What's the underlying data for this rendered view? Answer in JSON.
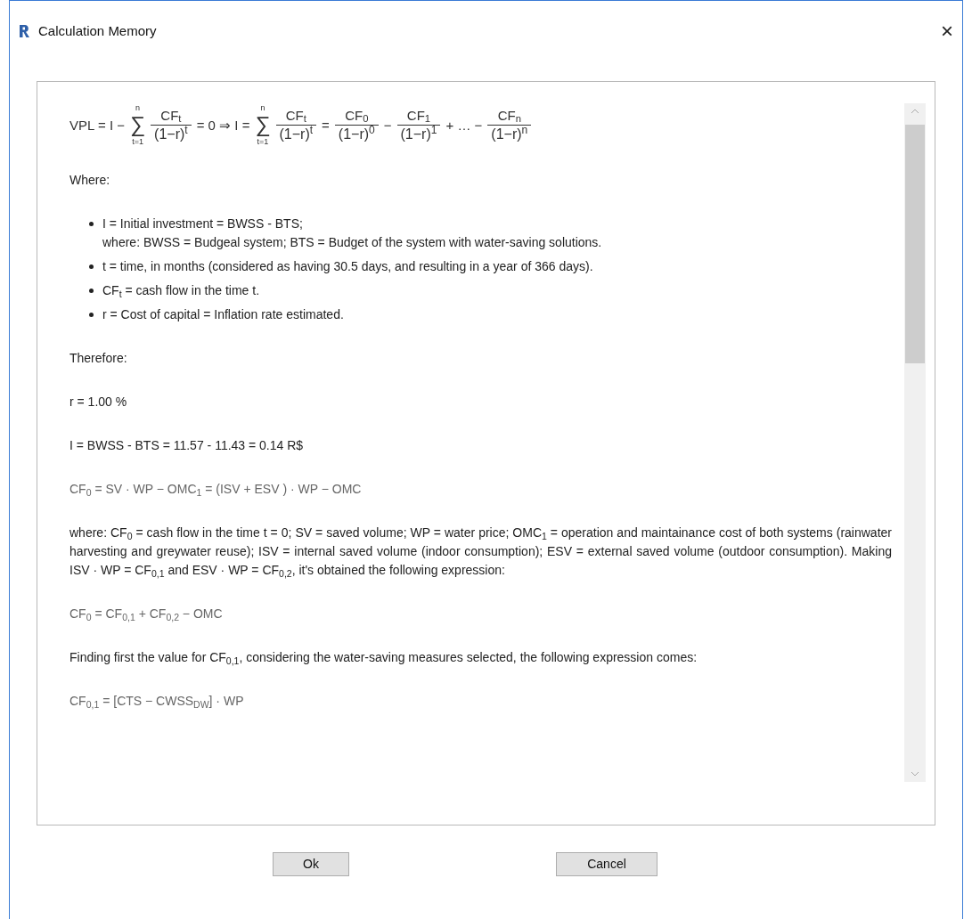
{
  "window": {
    "title": "Calculation Memory",
    "close": "×"
  },
  "content": [
    {
      "kind": "equation",
      "parts": [
        {
          "kind": "text",
          "text": "VPL = I −"
        },
        {
          "kind": "sum",
          "symbol": "∑",
          "top": "n",
          "bottom": "t=1"
        },
        {
          "kind": "frac",
          "num": "CF$_{t}$",
          "den": "(1−r)$^{t}$"
        },
        {
          "kind": "text",
          "text": "= 0 ⇒ I ="
        },
        {
          "kind": "sum",
          "symbol": "∑",
          "top": "n",
          "bottom": "t=1"
        },
        {
          "kind": "frac",
          "num": "CF$_{t}$",
          "den": "(1−r)$^{t}$"
        },
        {
          "kind": "text",
          "text": "="
        },
        {
          "kind": "frac",
          "num": "CF$_{0}$",
          "den": "(1−r)$^{0}$"
        },
        {
          "kind": "text",
          "text": "−"
        },
        {
          "kind": "frac",
          "num": "CF$_{1}$",
          "den": "(1−r)$^{1}$"
        },
        {
          "kind": "text",
          "text": "+ … −"
        },
        {
          "kind": "frac",
          "num": "CF$_{n}$",
          "den": "(1−r)$^{n}$"
        }
      ]
    },
    {
      "kind": "paragraph",
      "text": "Where:"
    },
    {
      "kind": "bullets",
      "items": [
        {
          "lines": [
            "I = Initial investment = BWSS - BTS;",
            "where: BWSS = Budgeal system; BTS = Budget of the system with water-saving solutions."
          ]
        },
        {
          "lines": [
            "t = time, in months (considered as having 30.5 days, and resulting in a year of 366 days)."
          ]
        },
        {
          "lines": [
            "CF$_{t}$ = cash flow in the time t."
          ]
        },
        {
          "lines": [
            "r = Cost of capital = Inflation rate estimated."
          ]
        }
      ]
    },
    {
      "kind": "paragraph",
      "text": "Therefore:"
    },
    {
      "kind": "paragraph",
      "text": "r = 1.00 %"
    },
    {
      "kind": "paragraph",
      "text": "I = BWSS - BTS = 11.57 - 11.43 = 0.14 R$"
    },
    {
      "kind": "formula",
      "text": "CF$_{0}$ = SV · WP − OMC$_{1}$ = (ISV + ESV ) · WP − OMC"
    },
    {
      "kind": "paragraph",
      "text": "where: CF$_{0}$ = cash flow in the time t = 0; SV = saved volume; WP = water price; OMC$_{1}$ = operation and maintainance cost of both systems (rainwater harvesting and greywater reuse); ISV = internal saved volume (indoor consumption); ESV = external saved volume (outdoor consumption). Making ISV · WP = CF$_{0,1}$ and ESV · WP = CF$_{0,2}$, it's obtained the following expression:"
    },
    {
      "kind": "formula",
      "text": "CF$_{0}$ = CF$_{0,1}$ + CF$_{0,2}$ − OMC"
    },
    {
      "kind": "paragraph",
      "text": "Finding first the value for CF$_{0,1}$, considering the water-saving measures selected, the following expression comes:"
    },
    {
      "kind": "formula",
      "text": "CF$_{0,1}$ = [CTS − CWSS$_{DW}$] · WP"
    }
  ],
  "buttons": [
    "Ok",
    "Cancel"
  ]
}
